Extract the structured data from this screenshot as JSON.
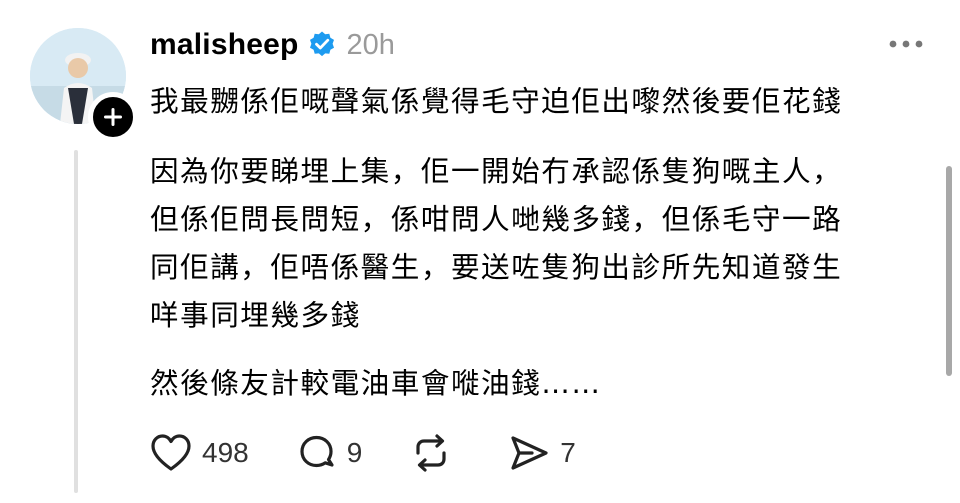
{
  "post": {
    "username": "malisheep",
    "timestamp": "20h",
    "verified": true,
    "body": {
      "line1": "我最嬲係佢嘅聲氣係覺得毛守迫佢出嚟然後要佢花錢",
      "line2": "因為你要睇埋上集，佢一開始冇承認係隻狗嘅主人，",
      "line3": "但係佢問長問短，係咁問人哋幾多錢，但係毛守一路",
      "line4": "同佢講，佢唔係醫生，要送咗隻狗出診所先知道發生",
      "line5": "咩事同埋幾多錢",
      "line6": "然後條友計較電油車會嘥油錢……"
    },
    "actions": {
      "likes": "498",
      "replies": "9",
      "shares": "7"
    }
  },
  "colors": {
    "verified_blue": "#1d9bf0",
    "text": "#000000",
    "muted": "#9a9a9a",
    "thread_line": "#e0e0e0"
  },
  "icons": [
    "follow-plus-icon",
    "verified-badge-icon",
    "more-options-icon",
    "heart-icon",
    "comment-icon",
    "repost-icon",
    "share-icon"
  ]
}
